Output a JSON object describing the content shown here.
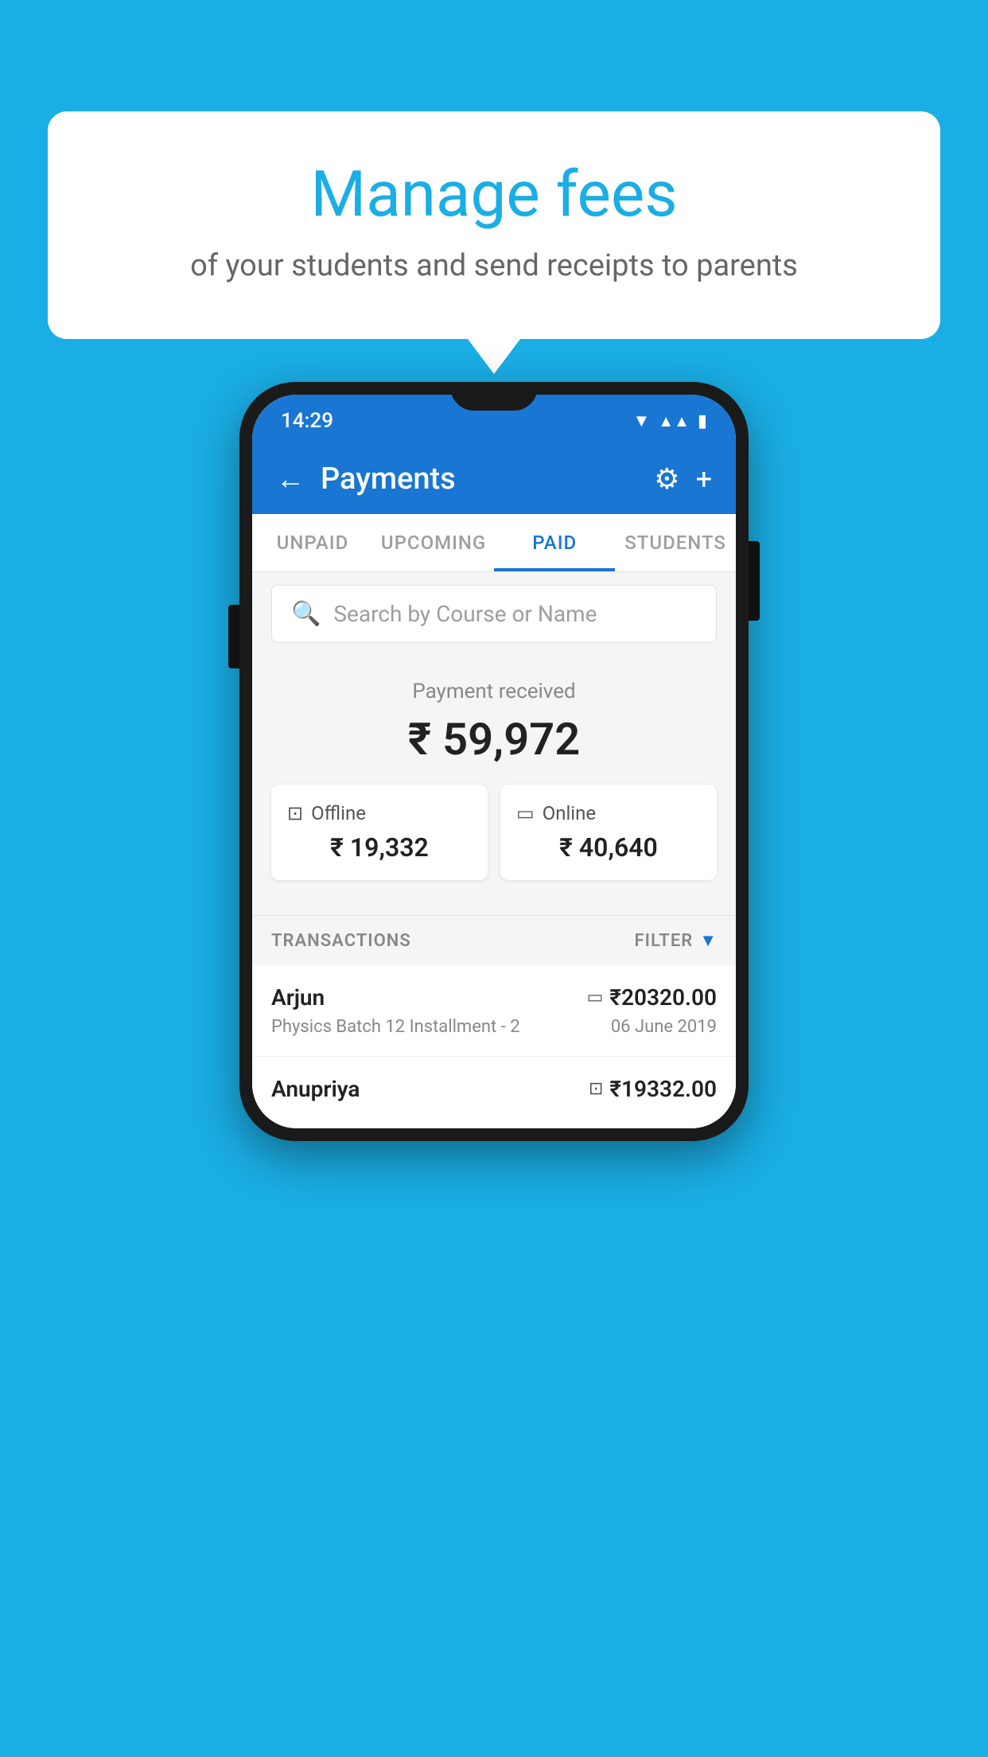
{
  "page": {
    "background_color": "#1AAEE5"
  },
  "speech_bubble": {
    "title": "Manage fees",
    "subtitle": "of your students and send receipts to parents"
  },
  "status_bar": {
    "time": "14:29",
    "icons": [
      "wifi",
      "signal",
      "battery"
    ]
  },
  "app_header": {
    "title": "Payments",
    "back_label": "←",
    "settings_label": "⚙",
    "add_label": "+"
  },
  "tabs": [
    {
      "label": "UNPAID",
      "active": false
    },
    {
      "label": "UPCOMING",
      "active": false
    },
    {
      "label": "PAID",
      "active": true
    },
    {
      "label": "STUDENTS",
      "active": false
    }
  ],
  "search": {
    "placeholder": "Search by Course or Name"
  },
  "payment_section": {
    "label": "Payment received",
    "amount": "₹ 59,972",
    "offline": {
      "type": "Offline",
      "amount": "₹ 19,332"
    },
    "online": {
      "type": "Online",
      "amount": "₹ 40,640"
    }
  },
  "transactions": {
    "label": "TRANSACTIONS",
    "filter_label": "FILTER",
    "items": [
      {
        "name": "Arjun",
        "course": "Physics Batch 12 Installment - 2",
        "amount": "₹20320.00",
        "date": "06 June 2019",
        "payment_type": "online"
      },
      {
        "name": "Anupriya",
        "course": "",
        "amount": "₹19332.00",
        "date": "",
        "payment_type": "offline"
      }
    ]
  }
}
